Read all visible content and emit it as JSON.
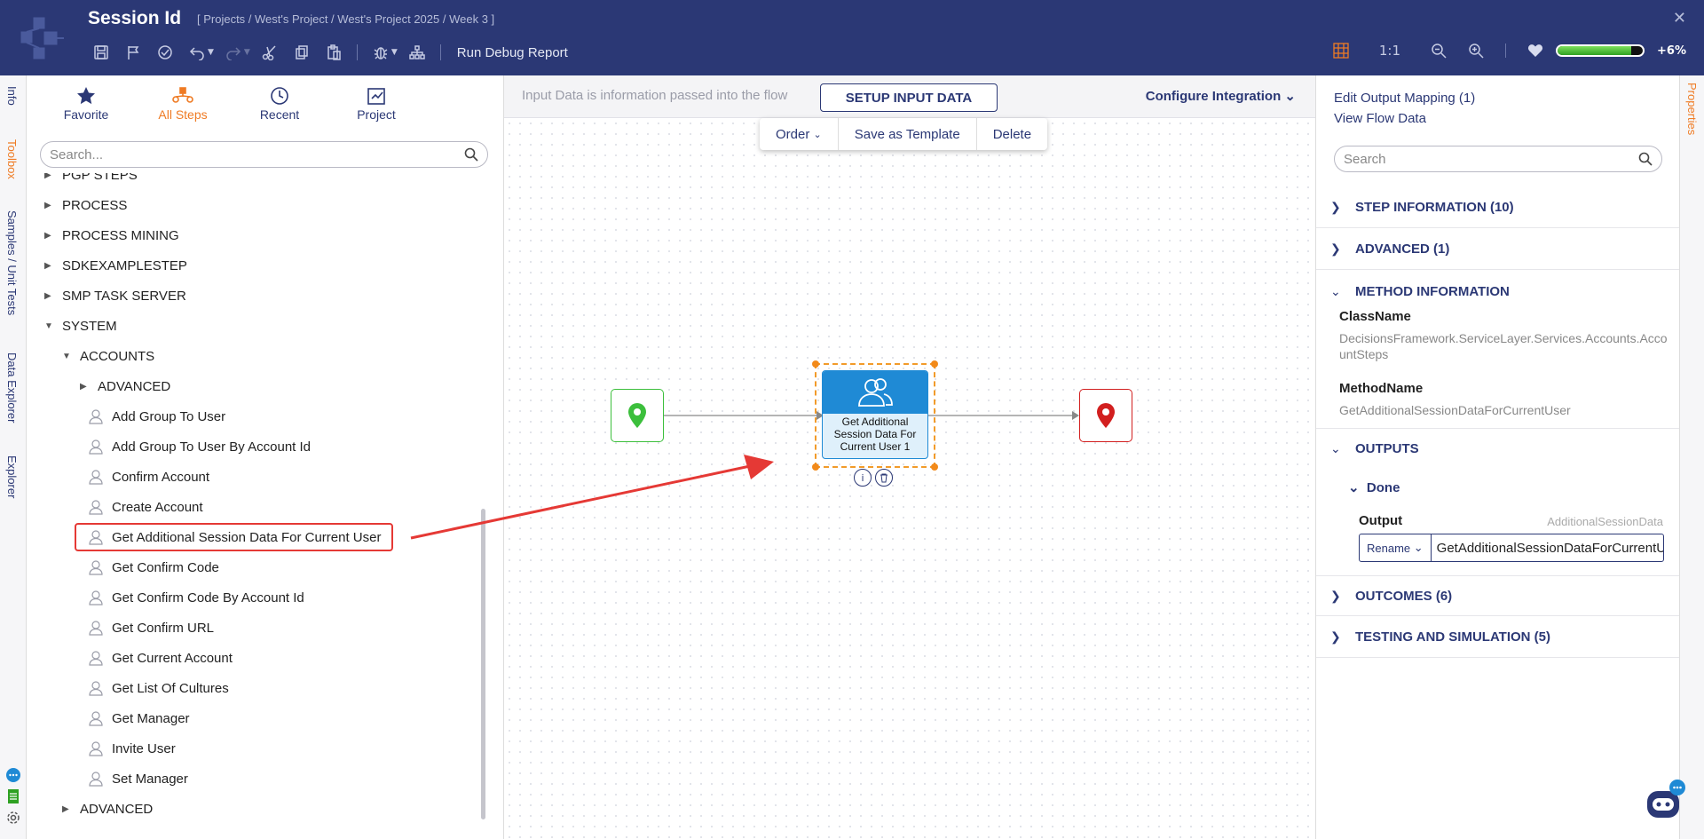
{
  "header": {
    "title": "Session Id",
    "breadcrumb": "[ Projects / West's Project / West's Project 2025 / Week 3 ]",
    "run_debug_report": "Run Debug Report",
    "zoom_ratio": "1:1",
    "progress_percent": 6,
    "progress_label": "+6%"
  },
  "left_tabs": [
    "Info",
    "Toolbox",
    "Samples / Unit Tests",
    "Data Explorer",
    "Explorer"
  ],
  "toolbox": {
    "tabs": [
      {
        "label": "Favorite",
        "icon": "star-icon"
      },
      {
        "label": "All Steps",
        "icon": "all-steps-icon"
      },
      {
        "label": "Recent",
        "icon": "clock-icon"
      },
      {
        "label": "Project",
        "icon": "project-icon"
      }
    ],
    "search_placeholder": "Search...",
    "tree": [
      {
        "label": "PGP STEPS",
        "level": 0,
        "type": "folder",
        "expanded": false
      },
      {
        "label": "PROCESS",
        "level": 0,
        "type": "folder",
        "expanded": false
      },
      {
        "label": "PROCESS MINING",
        "level": 0,
        "type": "folder",
        "expanded": false
      },
      {
        "label": "SDKEXAMPLESTEP",
        "level": 0,
        "type": "folder",
        "expanded": false
      },
      {
        "label": "SMP TASK SERVER",
        "level": 0,
        "type": "folder",
        "expanded": false
      },
      {
        "label": "SYSTEM",
        "level": 0,
        "type": "folder",
        "expanded": true
      },
      {
        "label": "ACCOUNTS",
        "level": 1,
        "type": "folder",
        "expanded": true
      },
      {
        "label": "ADVANCED",
        "level": 2,
        "type": "folder",
        "expanded": false
      },
      {
        "label": "Add Group To User",
        "level": 2,
        "type": "step"
      },
      {
        "label": "Add Group To User By Account Id",
        "level": 2,
        "type": "step"
      },
      {
        "label": "Confirm Account",
        "level": 2,
        "type": "step"
      },
      {
        "label": "Create Account",
        "level": 2,
        "type": "step"
      },
      {
        "label": "Get Additional Session Data For Current User",
        "level": 2,
        "type": "step",
        "highlight": true
      },
      {
        "label": "Get Confirm Code",
        "level": 2,
        "type": "step"
      },
      {
        "label": "Get Confirm Code By Account Id",
        "level": 2,
        "type": "step"
      },
      {
        "label": "Get Confirm URL",
        "level": 2,
        "type": "step"
      },
      {
        "label": "Get Current Account",
        "level": 2,
        "type": "step"
      },
      {
        "label": "Get List Of Cultures",
        "level": 2,
        "type": "step"
      },
      {
        "label": "Get Manager",
        "level": 2,
        "type": "step"
      },
      {
        "label": "Invite User",
        "level": 2,
        "type": "step"
      },
      {
        "label": "Set Manager",
        "level": 2,
        "type": "step"
      },
      {
        "label": "ADVANCED",
        "level": 1,
        "type": "folder",
        "expanded": false
      }
    ]
  },
  "canvas": {
    "input_info": "Input Data is information passed into the flow",
    "setup_button": "SETUP INPUT DATA",
    "configure_integration": "Configure Integration",
    "context_bar": {
      "order": "Order",
      "save_template": "Save as Template",
      "delete": "Delete"
    },
    "step_label": "Get Additional Session Data For Current User 1"
  },
  "properties": {
    "tab_label": "Properties",
    "edit_output_mapping": "Edit Output Mapping (1)",
    "view_flow_data": "View Flow Data",
    "search_placeholder": "Search",
    "sections": {
      "step_information": "STEP INFORMATION (10)",
      "advanced": "ADVANCED (1)",
      "method_information": "METHOD INFORMATION",
      "outputs": "OUTPUTS",
      "outcomes": "OUTCOMES (6)",
      "testing": "TESTING AND SIMULATION (5)"
    },
    "class_name_label": "ClassName",
    "class_name_value": "DecisionsFramework.ServiceLayer.Services.Accounts.AccountSteps",
    "method_name_label": "MethodName",
    "method_name_value": "GetAdditionalSessionDataForCurrentUser",
    "done_label": "Done",
    "output_label": "Output",
    "output_type": "AdditionalSessionData",
    "rename_label": "Rename",
    "rename_value": "GetAdditionalSessionDataForCurrentUser"
  },
  "colors": {
    "header_bg": "#2b3875",
    "accent_orange": "#ef7b24",
    "step_blue": "#1f8ad5",
    "highlight_red": "#e53935"
  }
}
